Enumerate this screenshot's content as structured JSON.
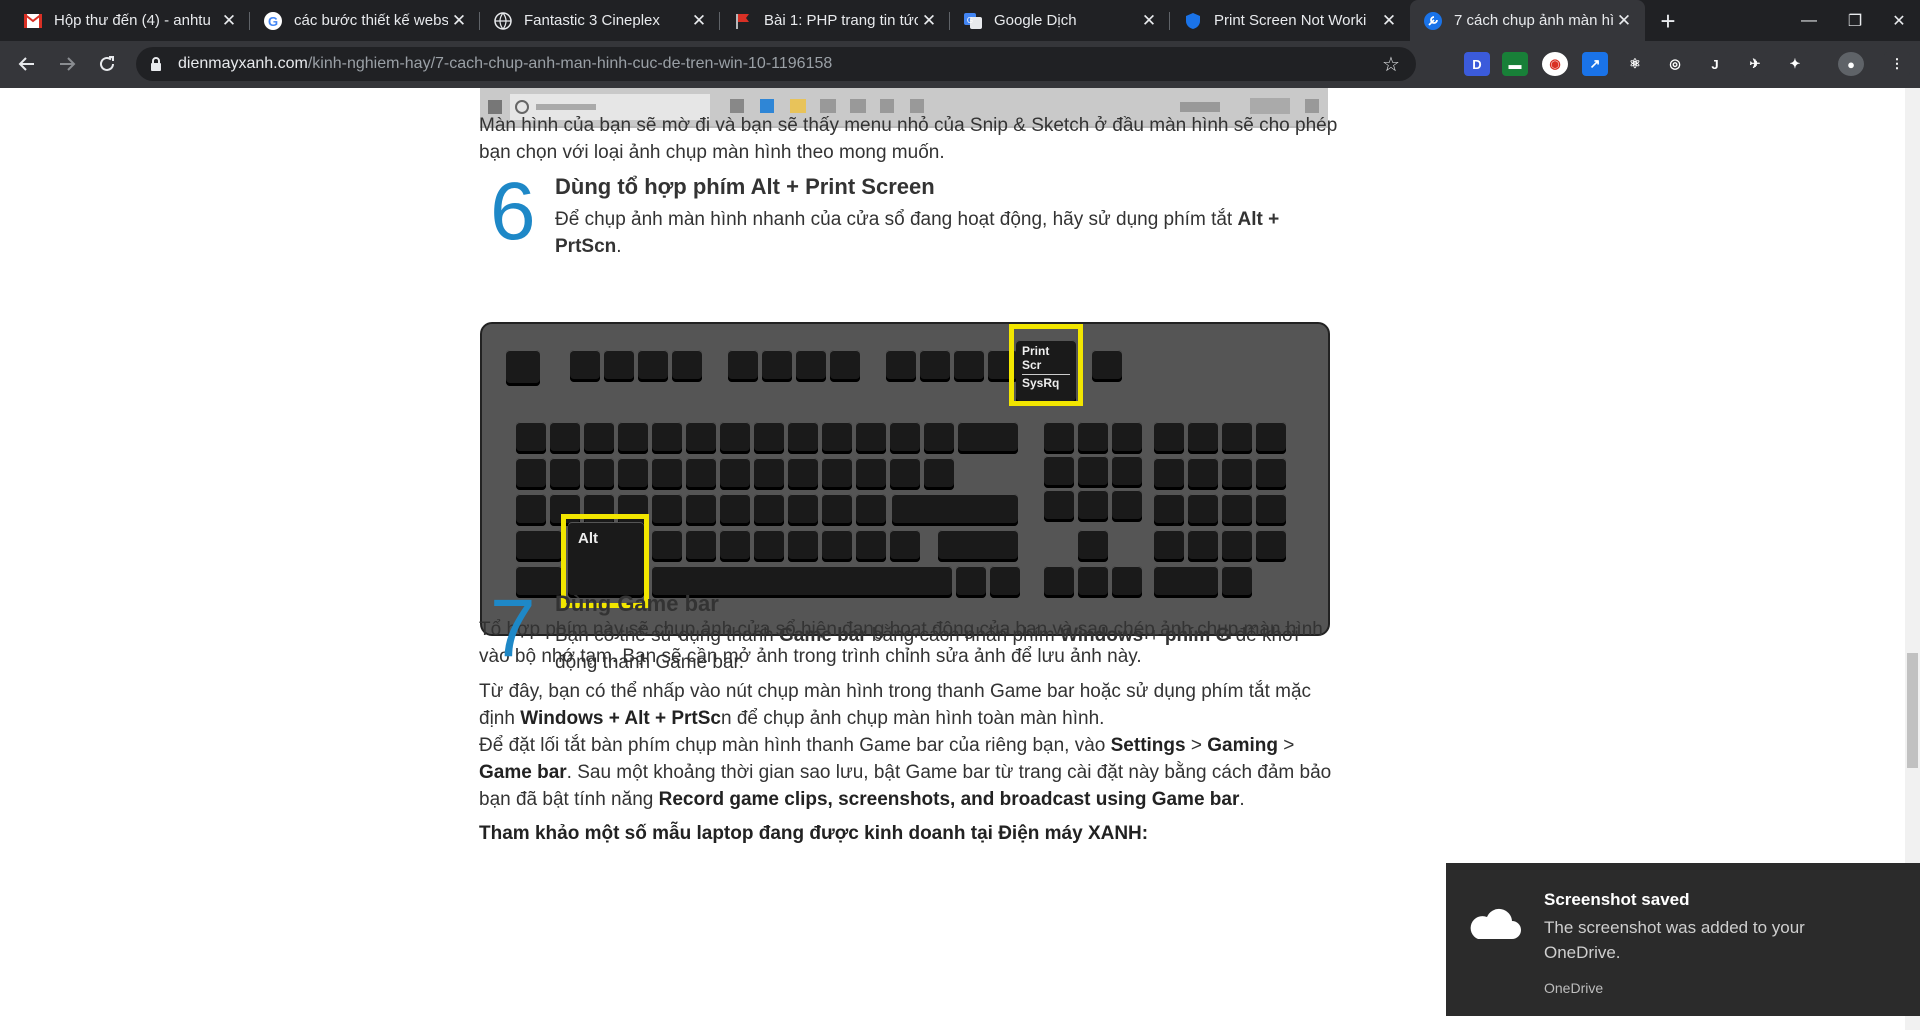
{
  "browser": {
    "tabs": [
      {
        "title": "Hộp thư đến (4) - anhtu",
        "icon": "gmail-icon",
        "active": false
      },
      {
        "title": "các bước thiết kế websi",
        "icon": "google-icon",
        "active": false
      },
      {
        "title": "Fantastic 3 Cineplex",
        "icon": "globe-icon",
        "active": false
      },
      {
        "title": "Bài 1: PHP trang tin tức",
        "icon": "redflag-icon",
        "active": false
      },
      {
        "title": "Google Dịch",
        "icon": "translate-icon",
        "active": false
      },
      {
        "title": "Print Screen Not Worki",
        "icon": "shield-icon",
        "active": false
      },
      {
        "title": "7 cách chụp ảnh màn hì",
        "icon": "wrench-icon",
        "active": true
      }
    ],
    "new_tab_label": "+",
    "window_controls": {
      "minimize": "—",
      "maximize": "❐",
      "close": "✕"
    },
    "address": {
      "domain": "dienmayxanh.com",
      "path": "/kinh-nghiem-hay/7-cach-chup-anh-man-hinh-cuc-de-tren-win-10-1196158"
    },
    "extensions": [
      {
        "icon": "d-ext-icon",
        "label": "D",
        "color": "#3b5bdb"
      },
      {
        "icon": "sheet-ext-icon",
        "label": "▬",
        "color": "#188038"
      },
      {
        "icon": "record-ext-icon",
        "label": "◉",
        "color": "#d93025"
      },
      {
        "icon": "expand-ext-icon",
        "label": "↗",
        "color": "#1a73e8"
      },
      {
        "icon": "react-ext-icon",
        "label": "⚛",
        "color": "#35363a"
      },
      {
        "icon": "target-ext-icon",
        "label": "◎",
        "color": "#35363a"
      },
      {
        "icon": "j-ext-icon",
        "label": "J",
        "color": "#35363a"
      },
      {
        "icon": "bird-ext-icon",
        "label": "✈",
        "color": "#35363a"
      },
      {
        "icon": "puzzle-ext-icon",
        "label": "✦",
        "color": "#35363a"
      },
      {
        "icon": "profile-avatar-icon",
        "label": "●",
        "color": "#5f6368"
      },
      {
        "icon": "menu-icon",
        "label": "⋮",
        "color": "#35363a"
      }
    ]
  },
  "article": {
    "para_snip": "Màn hình của bạn sẽ mờ đi và bạn sẽ thấy menu nhỏ của Snip & Sketch ở đầu màn hình sẽ cho phép bạn chọn với loại ảnh chụp màn hình theo mong muốn.",
    "section6": {
      "number": "6",
      "heading": "Dùng tổ hợp phím Alt + Print Screen",
      "text_before": "Để chụp ảnh màn hình nhanh của cửa sổ đang hoạt động, hãy sử dụng phím tắt ",
      "text_bold": "Alt + PrtScn",
      "text_after": "."
    },
    "keyboard": {
      "print_key": [
        "Print",
        "Scr",
        "SysRq"
      ],
      "alt_key": "Alt"
    },
    "para_after_kb": "Tổ hợp phím này sẽ chụp ảnh cửa sổ hiện đang hoạt động của bạn và sao chép ảnh chụp màn hình vào bộ nhớ tạm. Bạn sẽ cần mở ảnh trong trình chỉnh sửa ảnh để lưu ảnh này.",
    "section7": {
      "number": "7",
      "heading": "Dùng Game bar",
      "t1": "Bạn có thể sử dụng thanh ",
      "b1": "Game bar",
      "t2": " bằng cách nhấn phím ",
      "b2": "Windows",
      "t3": " + ",
      "b3": "phím G",
      "t4": " để khởi động thanh Game bar."
    },
    "para_gamebar1": {
      "t1": "Từ đây, bạn có thể nhấp vào nút chụp màn hình trong thanh Game bar hoặc sử dụng phím tắt mặc định ",
      "b1": "Windows + Alt + PrtSc",
      "t2": "n để chụp ảnh chụp màn hình toàn màn hình."
    },
    "para_gamebar2": {
      "t1": "Để đặt lối tắt bàn phím chụp màn hình thanh Game bar của riêng bạn, vào ",
      "b1": "Settings",
      "t2": " > ",
      "b2": "Gaming",
      "t3": " > ",
      "b3": "Game bar",
      "t4": ". Sau một khoảng thời gian sao lưu, bật Game bar từ trang cài đặt này bằng cách đảm bảo bạn đã bật tính năng ",
      "b4": "Record game clips, screenshots, and broadcast using Game bar",
      "t5": "."
    },
    "para_ref": "Tham khảo một số mẫu laptop đang được kinh doanh tại Điện máy XANH:"
  },
  "toast": {
    "title": "Screenshot saved",
    "message": "The screenshot was added to your OneDrive.",
    "source": "OneDrive"
  }
}
